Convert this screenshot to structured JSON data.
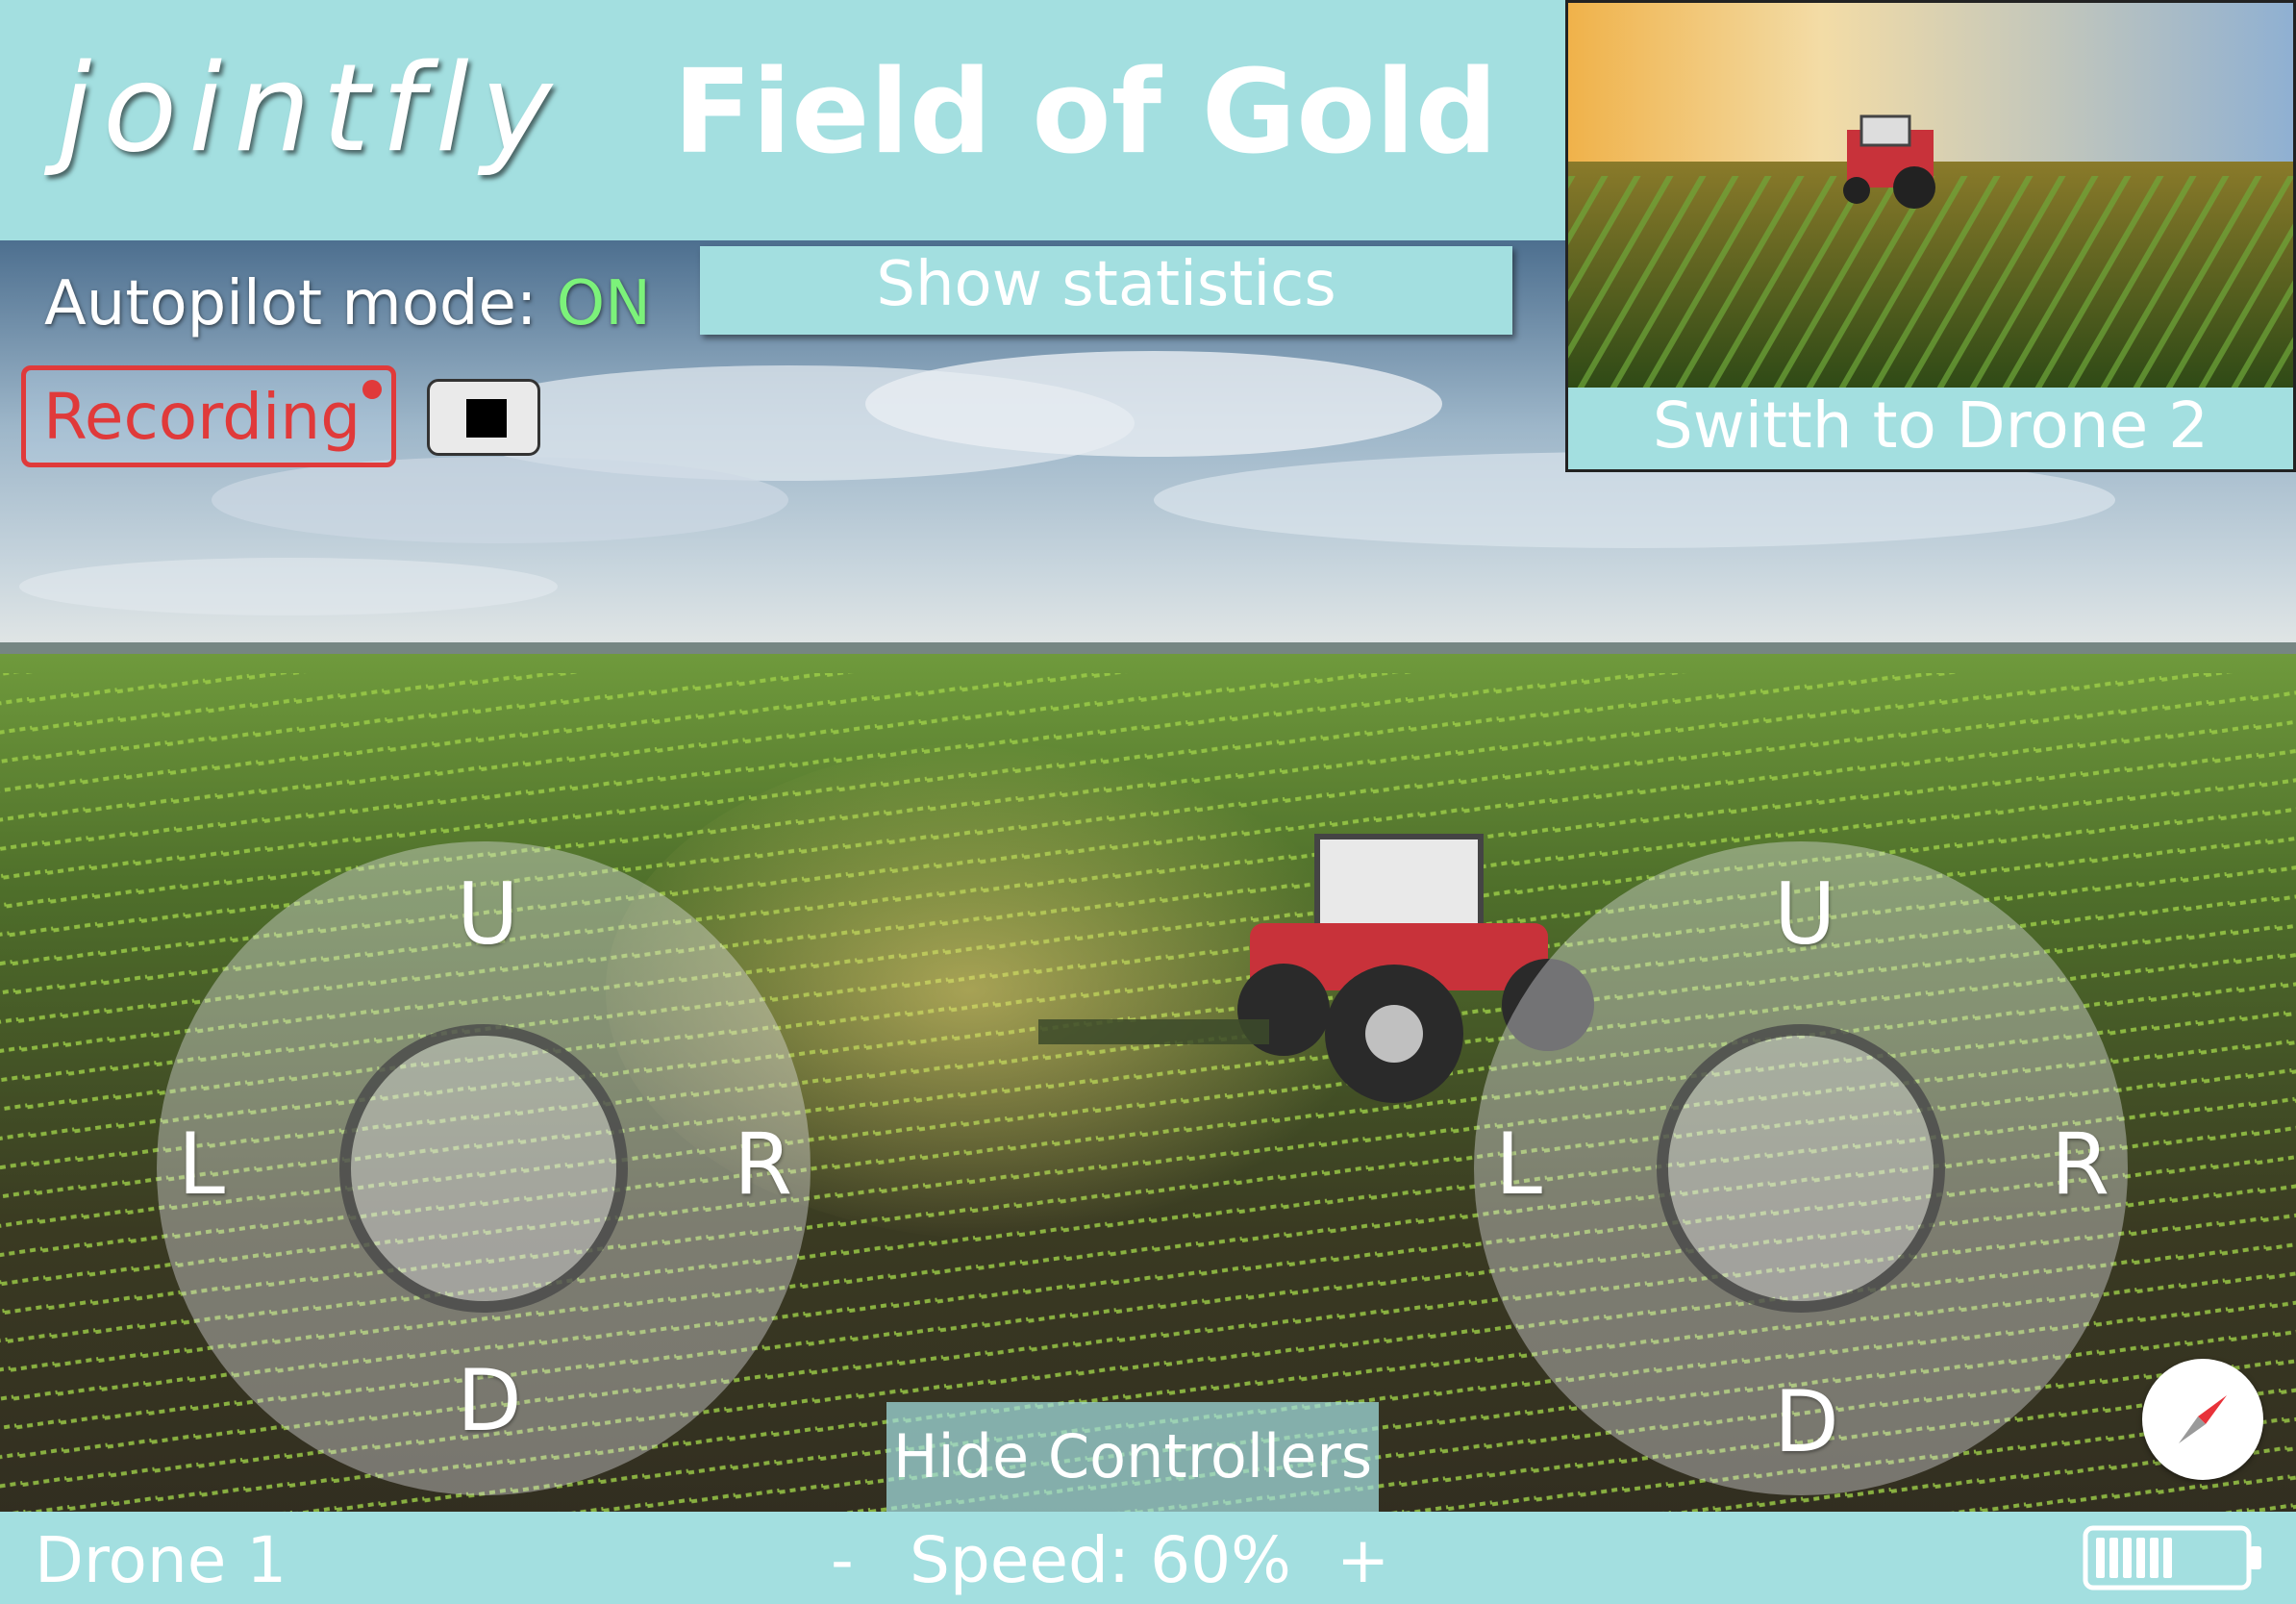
{
  "header": {
    "logo": "jointfly",
    "mission_title": "Field of Gold"
  },
  "overlay": {
    "autopilot_label": "Autopilot mode: ",
    "autopilot_state": "ON",
    "recording_label": "Recording",
    "show_statistics_label": "Show statistics",
    "hide_controllers_label": "Hide Controllers"
  },
  "preview": {
    "switch_label": "Switth to Drone 2"
  },
  "joysticks": {
    "left": {
      "up": "U",
      "down": "D",
      "left": "L",
      "right": "R"
    },
    "right": {
      "up": "U",
      "down": "D",
      "left": "L",
      "right": "R"
    }
  },
  "footer": {
    "drone_name": "Drone 1",
    "speed_minus": "-",
    "speed_text": "Speed: 60%",
    "speed_plus": "+",
    "battery_level": 0.8
  },
  "colors": {
    "accent": "#a3dfe0",
    "recording": "#e03a3a",
    "autopilot_on": "#7cf27a"
  },
  "icons": [
    "stop-icon",
    "compass-icon",
    "battery-icon",
    "recording-dot-icon"
  ]
}
